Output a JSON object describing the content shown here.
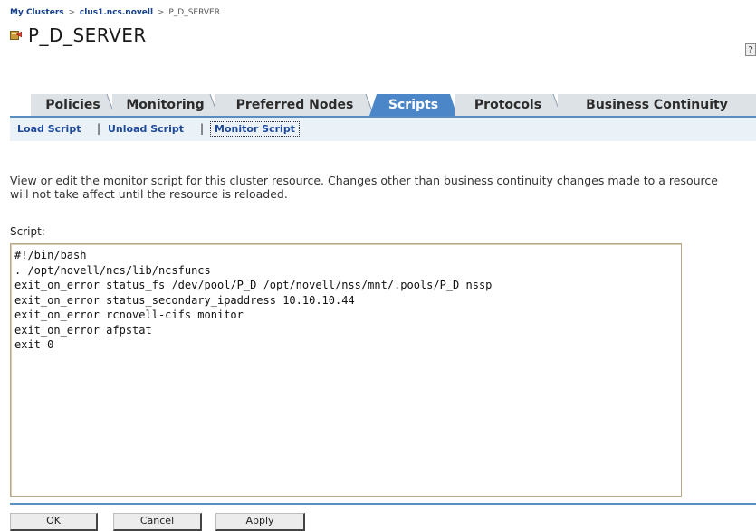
{
  "breadcrumb": {
    "items": [
      "My Clusters",
      "clus1.ncs.novell",
      "P_D_SERVER"
    ],
    "separator": ">"
  },
  "page": {
    "title": "P_D_SERVER",
    "help": "?"
  },
  "tabs": [
    {
      "label": "Policies",
      "active": false
    },
    {
      "label": "Monitoring",
      "active": false
    },
    {
      "label": "Preferred Nodes",
      "active": false
    },
    {
      "label": "Scripts",
      "active": true
    },
    {
      "label": "Protocols",
      "active": false
    },
    {
      "label": "Business Continuity",
      "active": false
    }
  ],
  "subtabs": {
    "items": [
      "Load Script",
      "Unload Script",
      "Monitor Script"
    ],
    "separator": "|",
    "active": "Monitor Script"
  },
  "description": "View or edit the monitor script for this cluster resource. Changes other than business continuity changes made to a resource will not take affect until the resource is reloaded.",
  "script": {
    "label": "Script:",
    "text": "#!/bin/bash\n. /opt/novell/ncs/lib/ncsfuncs\nexit_on_error status_fs /dev/pool/P_D /opt/novell/nss/mnt/.pools/P_D nssp\nexit_on_error status_secondary_ipaddress 10.10.10.44\nexit_on_error rcnovell-cifs monitor\nexit_on_error afpstat\nexit 0"
  },
  "buttons": {
    "ok": "OK",
    "cancel": "Cancel",
    "apply": "Apply"
  },
  "colors": {
    "tab_active": "#4a86c8",
    "tab_inactive": "#d8dde2",
    "accent_line": "#5a8ec2",
    "link": "#1d4a9a"
  }
}
